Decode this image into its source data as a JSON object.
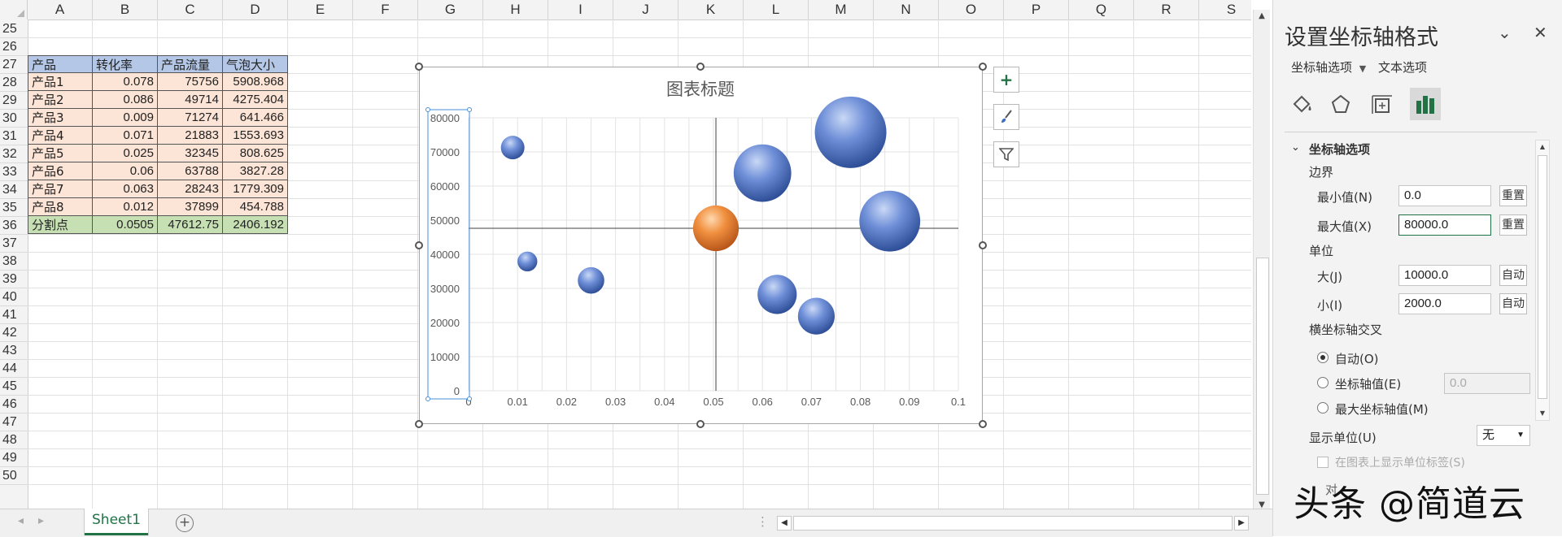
{
  "sheet": {
    "columns": [
      "A",
      "B",
      "C",
      "D",
      "E",
      "F",
      "G",
      "H",
      "I",
      "J",
      "K",
      "L",
      "M",
      "N",
      "O",
      "P",
      "Q",
      "R",
      "S"
    ],
    "rows": [
      "25",
      "26",
      "27",
      "28",
      "29",
      "30",
      "31",
      "32",
      "33",
      "34",
      "35",
      "36",
      "37",
      "38",
      "39",
      "40",
      "41",
      "42",
      "43",
      "44",
      "45",
      "46",
      "47",
      "48",
      "49",
      "50"
    ],
    "table": {
      "header": [
        "产品",
        "转化率",
        "产品流量",
        "气泡大小"
      ],
      "rows": [
        [
          "产品1",
          "0.078",
          "75756",
          "5908.968"
        ],
        [
          "产品2",
          "0.086",
          "49714",
          "4275.404"
        ],
        [
          "产品3",
          "0.009",
          "71274",
          "641.466"
        ],
        [
          "产品4",
          "0.071",
          "21883",
          "1553.693"
        ],
        [
          "产品5",
          "0.025",
          "32345",
          "808.625"
        ],
        [
          "产品6",
          "0.06",
          "63788",
          "3827.28"
        ],
        [
          "产品7",
          "0.063",
          "28243",
          "1779.309"
        ],
        [
          "产品8",
          "0.012",
          "37899",
          "454.788"
        ]
      ],
      "split": [
        "分割点",
        "0.0505",
        "47612.75",
        "2406.192"
      ]
    },
    "colors": {
      "header_fill": "#b4c7e7",
      "data_fill": "#fce4d6",
      "split_fill": "#c6e0b4"
    }
  },
  "tabs": {
    "sheet_name": "Sheet1",
    "add_icon": "plus-circle-icon"
  },
  "chart": {
    "buttons": [
      "+",
      "🖌",
      "⏷"
    ]
  },
  "chart_data": {
    "type": "bubble",
    "title": "图表标题",
    "xlim": [
      0,
      0.1
    ],
    "ylim": [
      0,
      80000
    ],
    "x_ticks": [
      "0",
      "0.01",
      "0.02",
      "0.03",
      "0.04",
      "0.05",
      "0.06",
      "0.07",
      "0.08",
      "0.09",
      "0.1"
    ],
    "y_ticks": [
      "0",
      "10000",
      "20000",
      "30000",
      "40000",
      "50000",
      "60000",
      "70000",
      "80000"
    ],
    "points": [
      {
        "x": 0.078,
        "y": 75756,
        "size": 5908.968
      },
      {
        "x": 0.086,
        "y": 49714,
        "size": 4275.404
      },
      {
        "x": 0.009,
        "y": 71274,
        "size": 641.466
      },
      {
        "x": 0.071,
        "y": 21883,
        "size": 1553.693
      },
      {
        "x": 0.025,
        "y": 32345,
        "size": 808.625
      },
      {
        "x": 0.06,
        "y": 63788,
        "size": 3827.28
      },
      {
        "x": 0.063,
        "y": 28243,
        "size": 1779.309
      },
      {
        "x": 0.012,
        "y": 37899,
        "size": 454.788
      },
      {
        "x": 0.0505,
        "y": 47612.75,
        "size": 2406.192
      }
    ],
    "highlight_index": 8,
    "crosshair": {
      "x": 0.0505,
      "y": 47612.75
    },
    "colors": {
      "bubble": "#5b7fcf",
      "highlight": "#ee8a3a"
    }
  },
  "pane": {
    "title": "设置坐标轴格式",
    "tab_axis": "坐标轴选项",
    "tab_text": "文本选项",
    "section": "坐标轴选项",
    "bounds_label": "边界",
    "min_label": "最小值(N)",
    "min_value": "0.0",
    "max_label": "最大值(X)",
    "max_value": "80000.0",
    "reset": "重置",
    "units_label": "单位",
    "major_label": "大(J)",
    "major_value": "10000.0",
    "minor_label": "小(I)",
    "minor_value": "2000.0",
    "auto": "自动",
    "cross_label": "横坐标轴交叉",
    "radio_auto": "自动(O)",
    "radio_value": "坐标轴值(E)",
    "radio_value_input": "0.0",
    "radio_max": "最大坐标轴值(M)",
    "display_units_label": "显示单位(U)",
    "display_units_value": "无",
    "show_units_label": "在图表上显示单位标签(S)",
    "partial": "对"
  },
  "watermark": "头条 @简道云"
}
